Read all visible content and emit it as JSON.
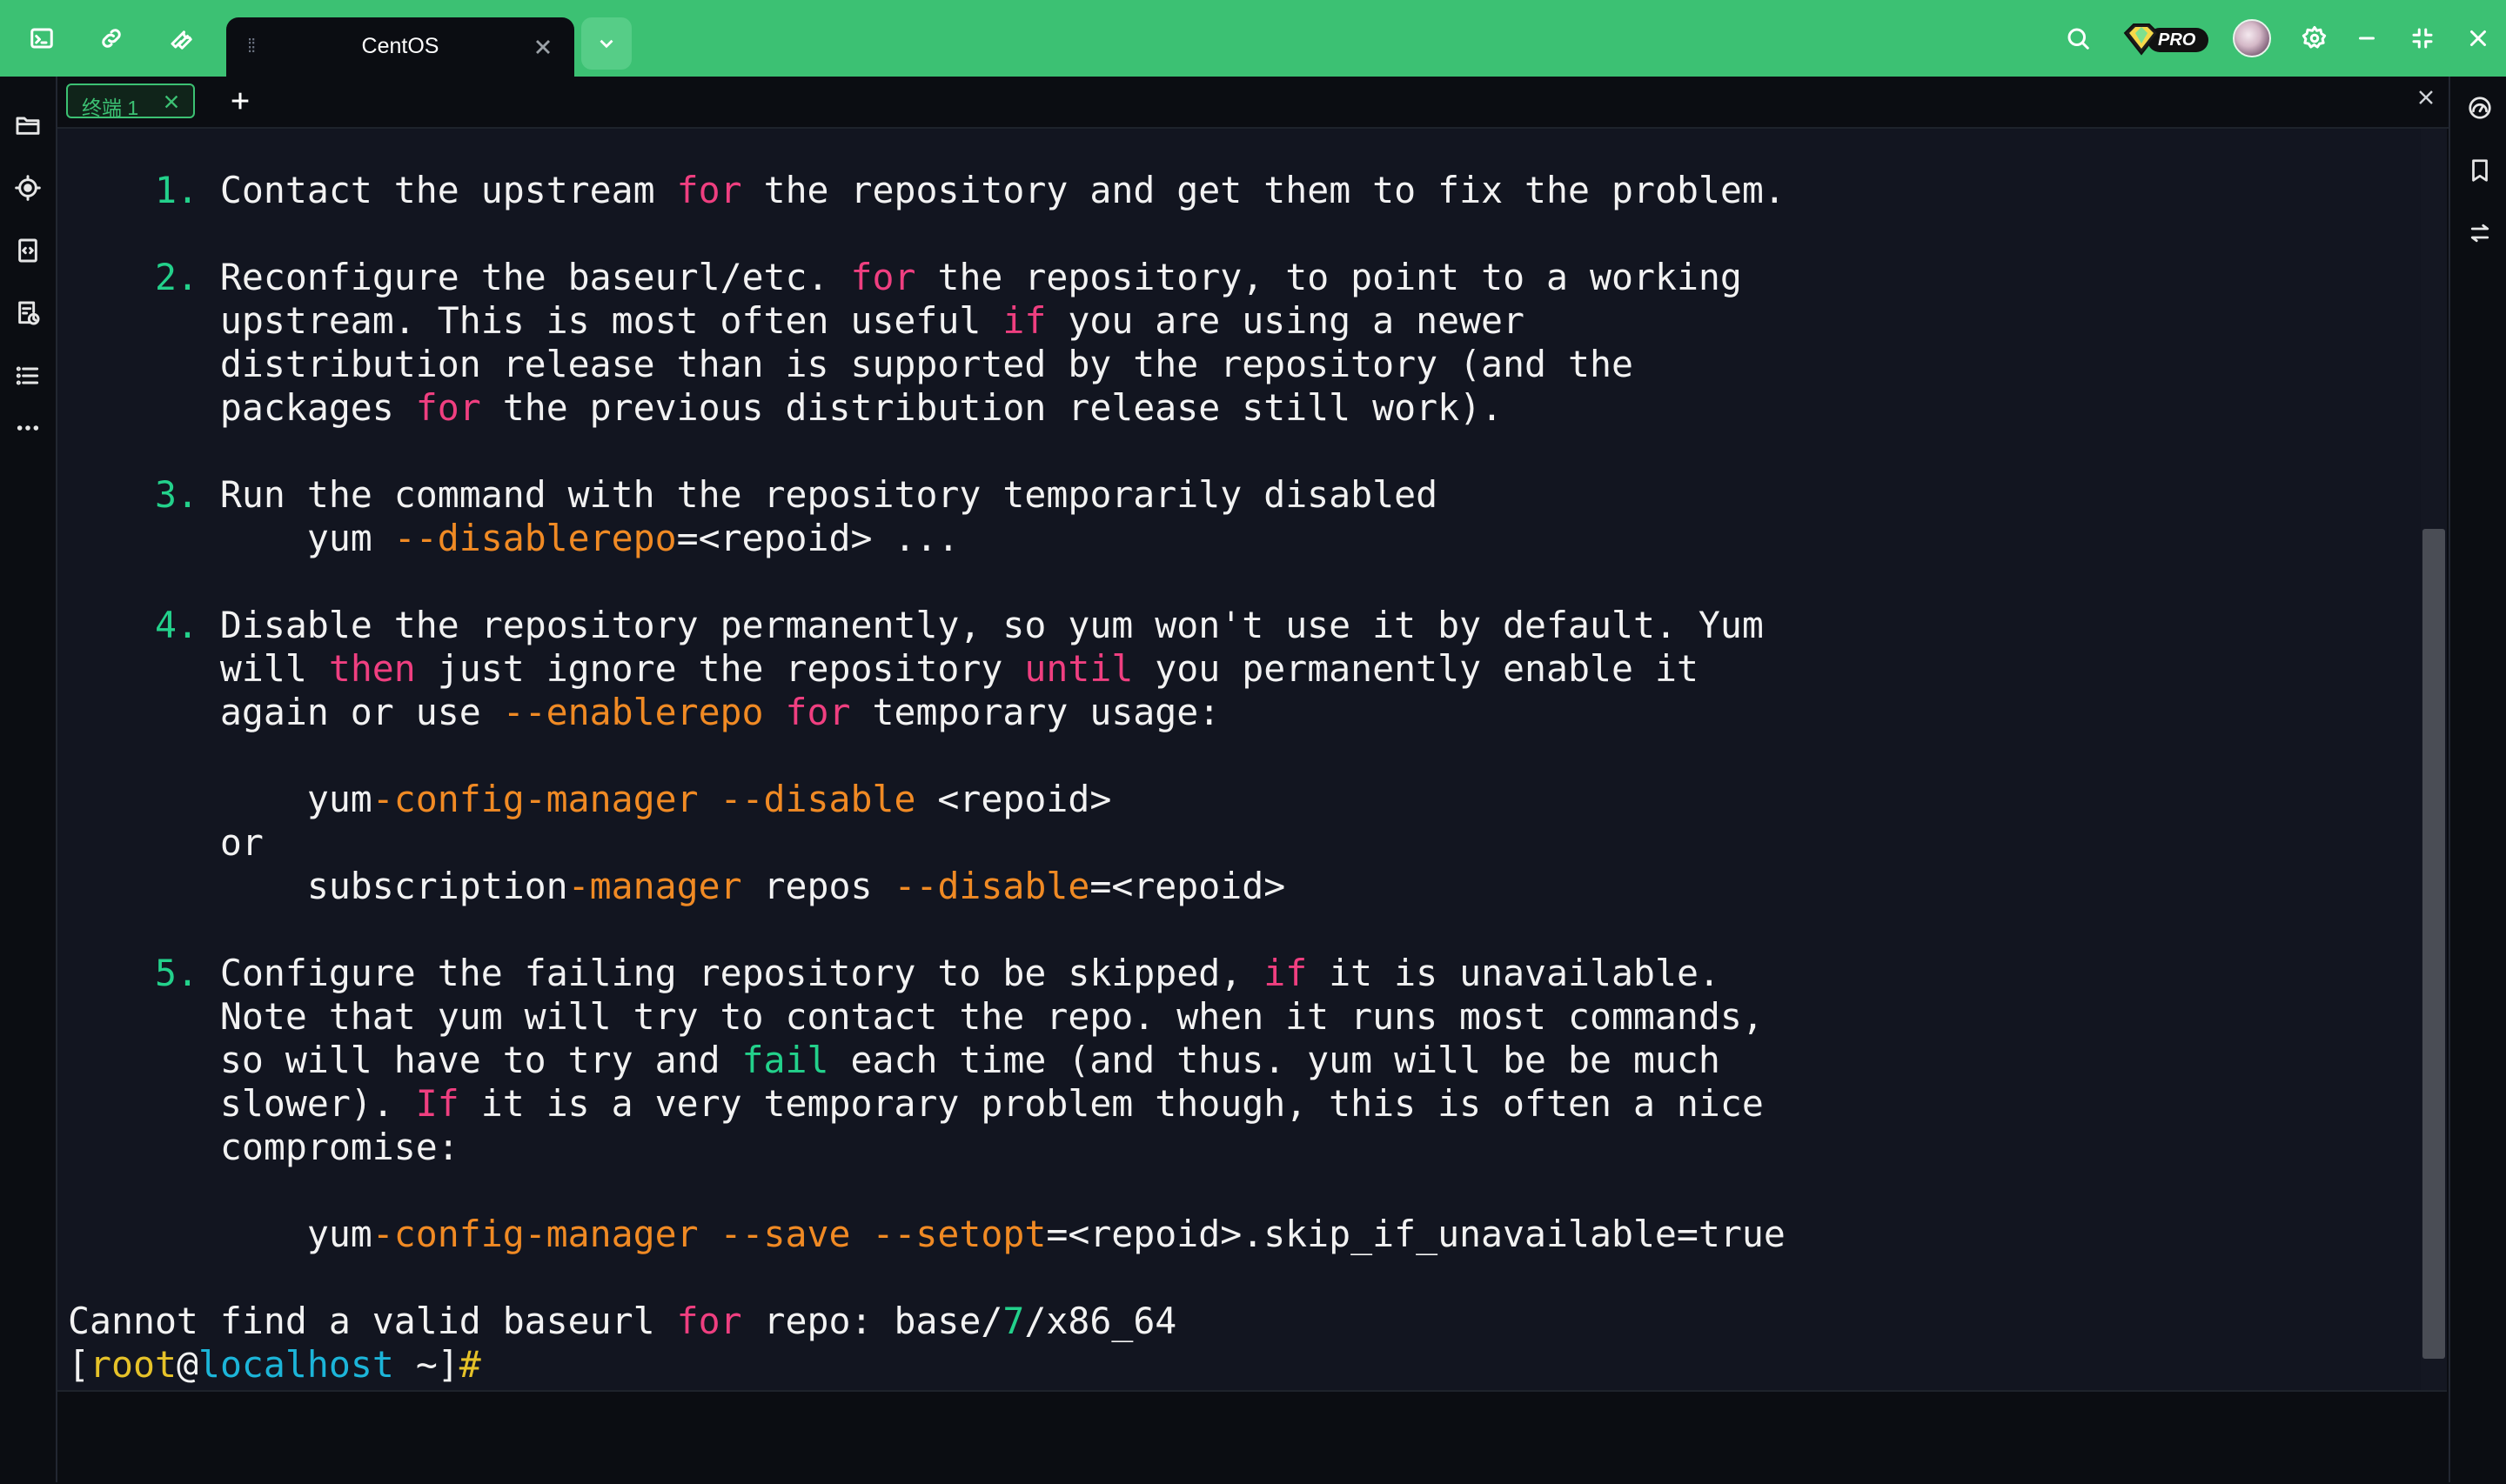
{
  "window": {
    "active_tab_title": "CentOS",
    "pro_badge": "PRO",
    "accent_color": "#3cc173"
  },
  "topbar_icons": [
    "terminal-icon",
    "link-icon",
    "wrench-icon",
    "chevron-down-icon",
    "search-icon",
    "pro-gem-icon",
    "avatar",
    "gear-icon",
    "minimize-icon",
    "restore-icon",
    "close-icon"
  ],
  "left_sidebar_icons": [
    "folder-icon",
    "target-icon",
    "code-file-icon",
    "history-file-icon",
    "list-icon",
    "more-icon"
  ],
  "right_sidebar_icons": [
    "dashboard-gauge-icon",
    "bookmark-icon",
    "transfer-icon"
  ],
  "terminal_tab": {
    "label": "终端 1"
  },
  "terminal": {
    "lines": [
      [
        [
          "    ",
          ""
        ],
        [
          "1.",
          "g"
        ],
        [
          " Contact the upstream ",
          ""
        ],
        [
          "for",
          "p"
        ],
        [
          " the repository and get them to fix the problem.",
          ""
        ]
      ],
      [
        [
          "",
          ""
        ]
      ],
      [
        [
          "    ",
          ""
        ],
        [
          "2.",
          "g"
        ],
        [
          " Reconfigure the baseurl/etc. ",
          ""
        ],
        [
          "for",
          "p"
        ],
        [
          " the repository, to point to a working",
          ""
        ]
      ],
      [
        [
          "       upstream. This is most often useful ",
          ""
        ],
        [
          "if",
          "p"
        ],
        [
          " you are using a newer",
          ""
        ]
      ],
      [
        [
          "       distribution release than is supported by the repository (and the",
          ""
        ]
      ],
      [
        [
          "       packages ",
          ""
        ],
        [
          "for",
          "p"
        ],
        [
          " the previous distribution release still work).",
          ""
        ]
      ],
      [
        [
          "",
          ""
        ]
      ],
      [
        [
          "    ",
          ""
        ],
        [
          "3.",
          "g"
        ],
        [
          " Run the command with the repository temporarily disabled",
          ""
        ]
      ],
      [
        [
          "           yum ",
          ""
        ],
        [
          "--disablerepo",
          "o"
        ],
        [
          "=<repoid> ...",
          ""
        ]
      ],
      [
        [
          "",
          ""
        ]
      ],
      [
        [
          "    ",
          ""
        ],
        [
          "4.",
          "g"
        ],
        [
          " Disable the repository permanently, so yum won't use it by default. Yum",
          ""
        ]
      ],
      [
        [
          "       will ",
          ""
        ],
        [
          "then",
          "p"
        ],
        [
          " just ignore the repository ",
          ""
        ],
        [
          "until",
          "p"
        ],
        [
          " you permanently enable it",
          ""
        ]
      ],
      [
        [
          "       again or use ",
          ""
        ],
        [
          "--enablerepo",
          "o"
        ],
        [
          " ",
          ""
        ],
        [
          "for",
          "p"
        ],
        [
          " temporary usage:",
          ""
        ]
      ],
      [
        [
          "",
          ""
        ]
      ],
      [
        [
          "           yum",
          ""
        ],
        [
          "-config-manager --disable",
          "o"
        ],
        [
          " <repoid>",
          ""
        ]
      ],
      [
        [
          "       or",
          ""
        ]
      ],
      [
        [
          "           subscription",
          ""
        ],
        [
          "-manager",
          "o"
        ],
        [
          " repos ",
          ""
        ],
        [
          "--disable",
          "o"
        ],
        [
          "=<repoid>",
          ""
        ]
      ],
      [
        [
          "",
          ""
        ]
      ],
      [
        [
          "    ",
          ""
        ],
        [
          "5.",
          "g"
        ],
        [
          " Configure the failing repository to be skipped, ",
          ""
        ],
        [
          "if",
          "p"
        ],
        [
          " it is unavailable.",
          ""
        ]
      ],
      [
        [
          "       Note that yum will try to contact the repo. when it runs most commands,",
          ""
        ]
      ],
      [
        [
          "       so will have to try and ",
          ""
        ],
        [
          "fail",
          "g"
        ],
        [
          " each time (and thus. yum will be be much",
          ""
        ]
      ],
      [
        [
          "       slower). ",
          ""
        ],
        [
          "If",
          "p"
        ],
        [
          " it is a very temporary problem though, this is often a nice",
          ""
        ]
      ],
      [
        [
          "       compromise:",
          ""
        ]
      ],
      [
        [
          "",
          ""
        ]
      ],
      [
        [
          "           yum",
          ""
        ],
        [
          "-config-manager --save --setopt",
          "o"
        ],
        [
          "=<repoid>.skip_if_unavailable=true",
          ""
        ]
      ],
      [
        [
          "",
          ""
        ]
      ],
      [
        [
          "Cannot find a valid baseurl ",
          ""
        ],
        [
          "for",
          "p"
        ],
        [
          " repo: base/",
          ""
        ],
        [
          "7",
          "g"
        ],
        [
          "/x86_64",
          ""
        ]
      ],
      [
        [
          "[",
          ""
        ],
        [
          "root",
          "yl"
        ],
        [
          "@",
          ""
        ],
        [
          "localhost",
          "cy"
        ],
        [
          " ~]",
          ""
        ],
        [
          "#",
          "yl"
        ]
      ]
    ],
    "scrollbar_position": 0.62
  }
}
